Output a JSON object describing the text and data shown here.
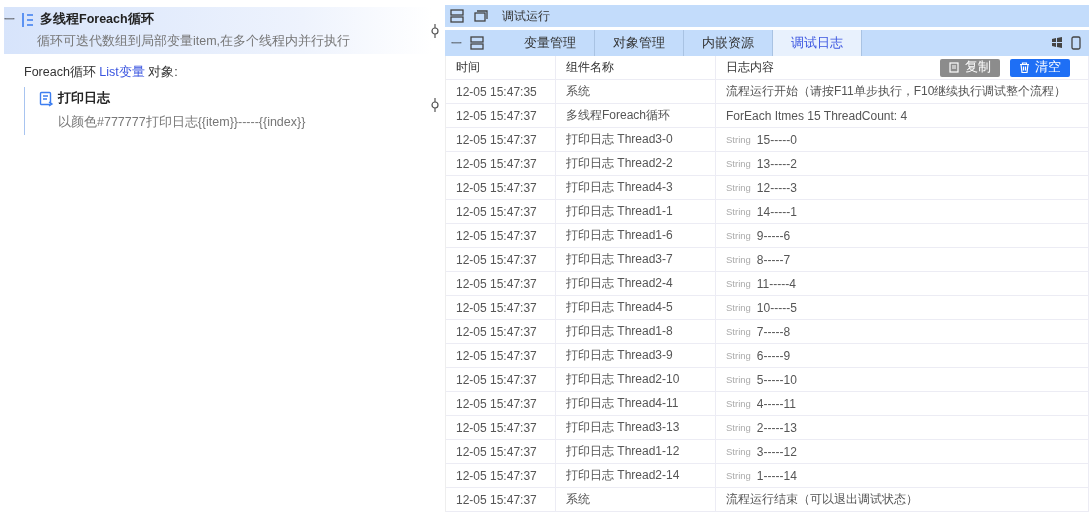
{
  "flow": {
    "loop": {
      "title": "多线程Foreach循环",
      "description": "循环可迭代数组到局部变量item,在多个线程内并行执行",
      "selected": true,
      "expanded": true,
      "collapse_glyph": "一"
    },
    "loop_label": {
      "before": "Foreach循环 ",
      "link": "List变量",
      "after": " 对象:"
    },
    "children": [
      {
        "title": "打印日志",
        "description": "以颜色#777777打印日志{{item}}-----{{index}}"
      }
    ]
  },
  "debug_panel": {
    "title": "调试运行",
    "collapse_glyph": "一",
    "tabs": [
      {
        "label": "变量管理",
        "selected": false
      },
      {
        "label": "对象管理",
        "selected": false
      },
      {
        "label": "内嵌资源",
        "selected": false
      },
      {
        "label": "调试日志",
        "selected": true
      }
    ],
    "columns": [
      "时间",
      "组件名称",
      "日志内容"
    ],
    "buttons": [
      {
        "label": "复制",
        "kind": "copy"
      },
      {
        "label": "清空",
        "kind": "clear"
      }
    ],
    "rows": [
      {
        "time": "12-05 15:47:35",
        "component": "系统",
        "content": "流程运行开始（请按F11单步执行，F10继续执行调试整个流程）"
      },
      {
        "time": "12-05 15:47:37",
        "component": "多线程Foreach循环",
        "content": "ForEach Itmes 15 ThreadCount: 4"
      },
      {
        "time": "12-05 15:47:37",
        "component": "打印日志 Thread3-0",
        "tag": "String",
        "content": "15-----0"
      },
      {
        "time": "12-05 15:47:37",
        "component": "打印日志 Thread2-2",
        "tag": "String",
        "content": "13-----2"
      },
      {
        "time": "12-05 15:47:37",
        "component": "打印日志 Thread4-3",
        "tag": "String",
        "content": "12-----3"
      },
      {
        "time": "12-05 15:47:37",
        "component": "打印日志 Thread1-1",
        "tag": "String",
        "content": "14-----1"
      },
      {
        "time": "12-05 15:47:37",
        "component": "打印日志 Thread1-6",
        "tag": "String",
        "content": "9-----6"
      },
      {
        "time": "12-05 15:47:37",
        "component": "打印日志 Thread3-7",
        "tag": "String",
        "content": "8-----7"
      },
      {
        "time": "12-05 15:47:37",
        "component": "打印日志 Thread2-4",
        "tag": "String",
        "content": "11-----4"
      },
      {
        "time": "12-05 15:47:37",
        "component": "打印日志 Thread4-5",
        "tag": "String",
        "content": "10-----5"
      },
      {
        "time": "12-05 15:47:37",
        "component": "打印日志 Thread1-8",
        "tag": "String",
        "content": "7-----8"
      },
      {
        "time": "12-05 15:47:37",
        "component": "打印日志 Thread3-9",
        "tag": "String",
        "content": "6-----9"
      },
      {
        "time": "12-05 15:47:37",
        "component": "打印日志 Thread2-10",
        "tag": "String",
        "content": "5-----10"
      },
      {
        "time": "12-05 15:47:37",
        "component": "打印日志 Thread4-11",
        "tag": "String",
        "content": "4-----11"
      },
      {
        "time": "12-05 15:47:37",
        "component": "打印日志 Thread3-13",
        "tag": "String",
        "content": "2-----13"
      },
      {
        "time": "12-05 15:47:37",
        "component": "打印日志 Thread1-12",
        "tag": "String",
        "content": "3-----12"
      },
      {
        "time": "12-05 15:47:37",
        "component": "打印日志 Thread2-14",
        "tag": "String",
        "content": "1-----14"
      },
      {
        "time": "12-05 15:47:37",
        "component": "系统",
        "content": "流程运行结束（可以退出调试状态）"
      }
    ]
  }
}
